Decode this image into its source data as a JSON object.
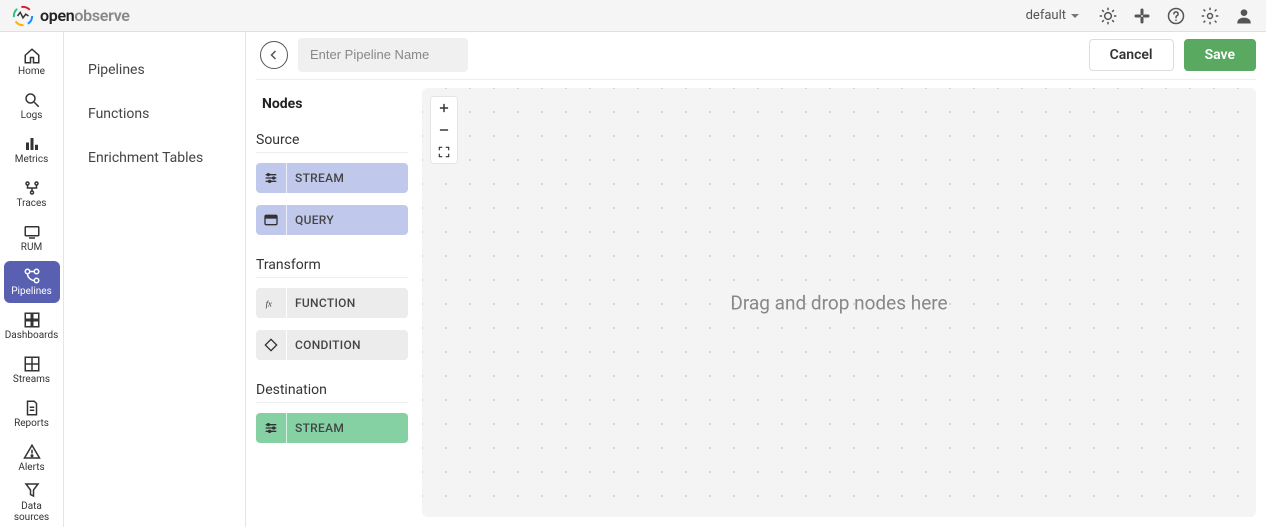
{
  "brand": {
    "open": "open",
    "observe": "observe"
  },
  "topbar": {
    "org_label": "default"
  },
  "nav": {
    "items": [
      {
        "label": "Home"
      },
      {
        "label": "Logs"
      },
      {
        "label": "Metrics"
      },
      {
        "label": "Traces"
      },
      {
        "label": "RUM"
      },
      {
        "label": "Pipelines"
      },
      {
        "label": "Dashboards"
      },
      {
        "label": "Streams"
      },
      {
        "label": "Reports"
      },
      {
        "label": "Alerts"
      },
      {
        "label": "Data sources"
      }
    ]
  },
  "secondary_sidebar": {
    "items": [
      {
        "label": "Pipelines"
      },
      {
        "label": "Functions"
      },
      {
        "label": "Enrichment Tables"
      }
    ]
  },
  "editor": {
    "name_placeholder": "Enter Pipeline Name",
    "name_value": "",
    "cancel_label": "Cancel",
    "save_label": "Save",
    "palette_title": "Nodes",
    "sections": {
      "source": {
        "title": "Source",
        "nodes": [
          {
            "label": "STREAM"
          },
          {
            "label": "QUERY"
          }
        ]
      },
      "transform": {
        "title": "Transform",
        "nodes": [
          {
            "label": "FUNCTION"
          },
          {
            "label": "CONDITION"
          }
        ]
      },
      "destination": {
        "title": "Destination",
        "nodes": [
          {
            "label": "STREAM"
          }
        ]
      }
    },
    "canvas_placeholder": "Drag and drop nodes here"
  }
}
